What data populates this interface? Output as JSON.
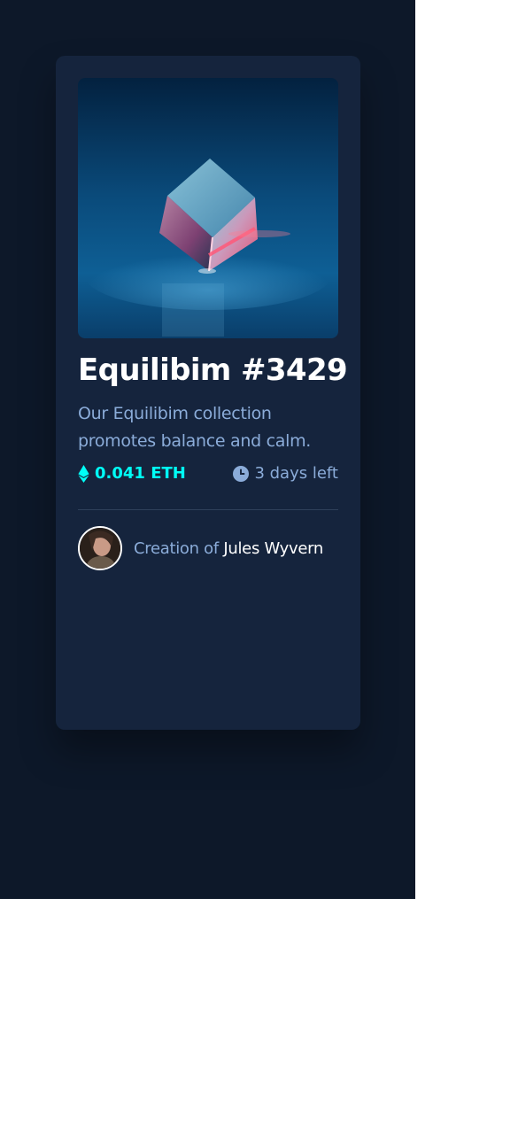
{
  "card": {
    "image_alt": "Equilibrium glass cube",
    "title": "Equilibim #3429",
    "description": "Our Equilibim collection promotes balance and calm.",
    "price": "0.041 ETH",
    "time_left": "3 days left",
    "creator_prefix": "Creation of",
    "creator_name": "Jules Wyvern"
  },
  "icons": {
    "price": "ethereum-icon",
    "time": "clock-icon",
    "avatar": "creator-avatar"
  },
  "colors": {
    "page_background": "#0d1829",
    "card_background": "#15243d",
    "cyan": "#00fff7",
    "soft_blue": "#8bacd9",
    "white": "#ffffff",
    "divider": "#2e405a"
  }
}
